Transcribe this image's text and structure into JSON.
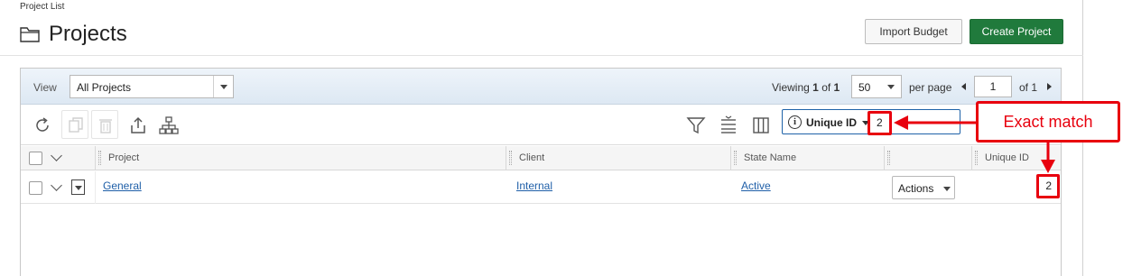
{
  "breadcrumb": "Project List",
  "page": {
    "title": "Projects"
  },
  "header_buttons": {
    "import_budget": "Import Budget",
    "create_project": "Create Project"
  },
  "view_bar": {
    "view_label": "View",
    "view_value": "All Projects",
    "viewing_prefix": "Viewing",
    "viewing_current": "1",
    "viewing_of": "of",
    "viewing_total": "1",
    "per_page_value": "50",
    "per_page_label": "per page",
    "page_number": "1",
    "of_pages": "of 1"
  },
  "toolbar": {
    "filter_field": "Unique ID",
    "filter_value": "2"
  },
  "grid": {
    "columns": [
      "Project",
      "Client",
      "State Name",
      "",
      "Unique ID"
    ],
    "rows": [
      {
        "project": "General",
        "client": "Internal",
        "state": "Active",
        "actions": "Actions",
        "unique_id": "2"
      }
    ]
  },
  "annotation": {
    "label": "Exact match",
    "color": "#e8000e"
  },
  "colors": {
    "create_button": "#207a3c",
    "link": "#1f5fa8",
    "filter_border": "#1e62a8"
  }
}
